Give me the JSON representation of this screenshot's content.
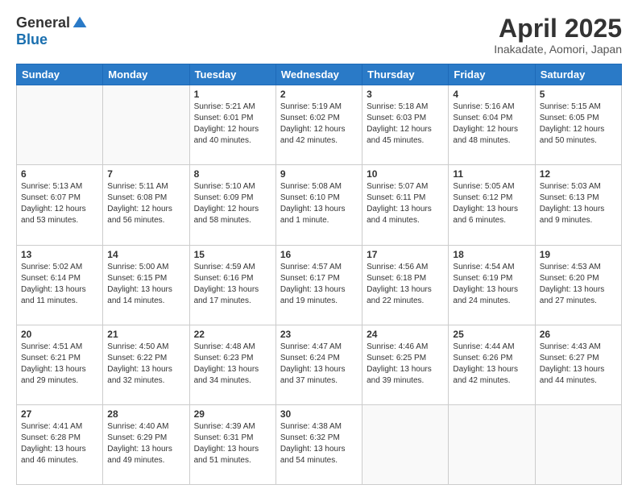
{
  "header": {
    "logo_general": "General",
    "logo_blue": "Blue",
    "month_title": "April 2025",
    "location": "Inakadate, Aomori, Japan"
  },
  "days_of_week": [
    "Sunday",
    "Monday",
    "Tuesday",
    "Wednesday",
    "Thursday",
    "Friday",
    "Saturday"
  ],
  "weeks": [
    [
      {
        "day": "",
        "sunrise": "",
        "sunset": "",
        "daylight": ""
      },
      {
        "day": "",
        "sunrise": "",
        "sunset": "",
        "daylight": ""
      },
      {
        "day": "1",
        "sunrise": "Sunrise: 5:21 AM",
        "sunset": "Sunset: 6:01 PM",
        "daylight": "Daylight: 12 hours and 40 minutes."
      },
      {
        "day": "2",
        "sunrise": "Sunrise: 5:19 AM",
        "sunset": "Sunset: 6:02 PM",
        "daylight": "Daylight: 12 hours and 42 minutes."
      },
      {
        "day": "3",
        "sunrise": "Sunrise: 5:18 AM",
        "sunset": "Sunset: 6:03 PM",
        "daylight": "Daylight: 12 hours and 45 minutes."
      },
      {
        "day": "4",
        "sunrise": "Sunrise: 5:16 AM",
        "sunset": "Sunset: 6:04 PM",
        "daylight": "Daylight: 12 hours and 48 minutes."
      },
      {
        "day": "5",
        "sunrise": "Sunrise: 5:15 AM",
        "sunset": "Sunset: 6:05 PM",
        "daylight": "Daylight: 12 hours and 50 minutes."
      }
    ],
    [
      {
        "day": "6",
        "sunrise": "Sunrise: 5:13 AM",
        "sunset": "Sunset: 6:07 PM",
        "daylight": "Daylight: 12 hours and 53 minutes."
      },
      {
        "day": "7",
        "sunrise": "Sunrise: 5:11 AM",
        "sunset": "Sunset: 6:08 PM",
        "daylight": "Daylight: 12 hours and 56 minutes."
      },
      {
        "day": "8",
        "sunrise": "Sunrise: 5:10 AM",
        "sunset": "Sunset: 6:09 PM",
        "daylight": "Daylight: 12 hours and 58 minutes."
      },
      {
        "day": "9",
        "sunrise": "Sunrise: 5:08 AM",
        "sunset": "Sunset: 6:10 PM",
        "daylight": "Daylight: 13 hours and 1 minute."
      },
      {
        "day": "10",
        "sunrise": "Sunrise: 5:07 AM",
        "sunset": "Sunset: 6:11 PM",
        "daylight": "Daylight: 13 hours and 4 minutes."
      },
      {
        "day": "11",
        "sunrise": "Sunrise: 5:05 AM",
        "sunset": "Sunset: 6:12 PM",
        "daylight": "Daylight: 13 hours and 6 minutes."
      },
      {
        "day": "12",
        "sunrise": "Sunrise: 5:03 AM",
        "sunset": "Sunset: 6:13 PM",
        "daylight": "Daylight: 13 hours and 9 minutes."
      }
    ],
    [
      {
        "day": "13",
        "sunrise": "Sunrise: 5:02 AM",
        "sunset": "Sunset: 6:14 PM",
        "daylight": "Daylight: 13 hours and 11 minutes."
      },
      {
        "day": "14",
        "sunrise": "Sunrise: 5:00 AM",
        "sunset": "Sunset: 6:15 PM",
        "daylight": "Daylight: 13 hours and 14 minutes."
      },
      {
        "day": "15",
        "sunrise": "Sunrise: 4:59 AM",
        "sunset": "Sunset: 6:16 PM",
        "daylight": "Daylight: 13 hours and 17 minutes."
      },
      {
        "day": "16",
        "sunrise": "Sunrise: 4:57 AM",
        "sunset": "Sunset: 6:17 PM",
        "daylight": "Daylight: 13 hours and 19 minutes."
      },
      {
        "day": "17",
        "sunrise": "Sunrise: 4:56 AM",
        "sunset": "Sunset: 6:18 PM",
        "daylight": "Daylight: 13 hours and 22 minutes."
      },
      {
        "day": "18",
        "sunrise": "Sunrise: 4:54 AM",
        "sunset": "Sunset: 6:19 PM",
        "daylight": "Daylight: 13 hours and 24 minutes."
      },
      {
        "day": "19",
        "sunrise": "Sunrise: 4:53 AM",
        "sunset": "Sunset: 6:20 PM",
        "daylight": "Daylight: 13 hours and 27 minutes."
      }
    ],
    [
      {
        "day": "20",
        "sunrise": "Sunrise: 4:51 AM",
        "sunset": "Sunset: 6:21 PM",
        "daylight": "Daylight: 13 hours and 29 minutes."
      },
      {
        "day": "21",
        "sunrise": "Sunrise: 4:50 AM",
        "sunset": "Sunset: 6:22 PM",
        "daylight": "Daylight: 13 hours and 32 minutes."
      },
      {
        "day": "22",
        "sunrise": "Sunrise: 4:48 AM",
        "sunset": "Sunset: 6:23 PM",
        "daylight": "Daylight: 13 hours and 34 minutes."
      },
      {
        "day": "23",
        "sunrise": "Sunrise: 4:47 AM",
        "sunset": "Sunset: 6:24 PM",
        "daylight": "Daylight: 13 hours and 37 minutes."
      },
      {
        "day": "24",
        "sunrise": "Sunrise: 4:46 AM",
        "sunset": "Sunset: 6:25 PM",
        "daylight": "Daylight: 13 hours and 39 minutes."
      },
      {
        "day": "25",
        "sunrise": "Sunrise: 4:44 AM",
        "sunset": "Sunset: 6:26 PM",
        "daylight": "Daylight: 13 hours and 42 minutes."
      },
      {
        "day": "26",
        "sunrise": "Sunrise: 4:43 AM",
        "sunset": "Sunset: 6:27 PM",
        "daylight": "Daylight: 13 hours and 44 minutes."
      }
    ],
    [
      {
        "day": "27",
        "sunrise": "Sunrise: 4:41 AM",
        "sunset": "Sunset: 6:28 PM",
        "daylight": "Daylight: 13 hours and 46 minutes."
      },
      {
        "day": "28",
        "sunrise": "Sunrise: 4:40 AM",
        "sunset": "Sunset: 6:29 PM",
        "daylight": "Daylight: 13 hours and 49 minutes."
      },
      {
        "day": "29",
        "sunrise": "Sunrise: 4:39 AM",
        "sunset": "Sunset: 6:31 PM",
        "daylight": "Daylight: 13 hours and 51 minutes."
      },
      {
        "day": "30",
        "sunrise": "Sunrise: 4:38 AM",
        "sunset": "Sunset: 6:32 PM",
        "daylight": "Daylight: 13 hours and 54 minutes."
      },
      {
        "day": "",
        "sunrise": "",
        "sunset": "",
        "daylight": ""
      },
      {
        "day": "",
        "sunrise": "",
        "sunset": "",
        "daylight": ""
      },
      {
        "day": "",
        "sunrise": "",
        "sunset": "",
        "daylight": ""
      }
    ]
  ]
}
